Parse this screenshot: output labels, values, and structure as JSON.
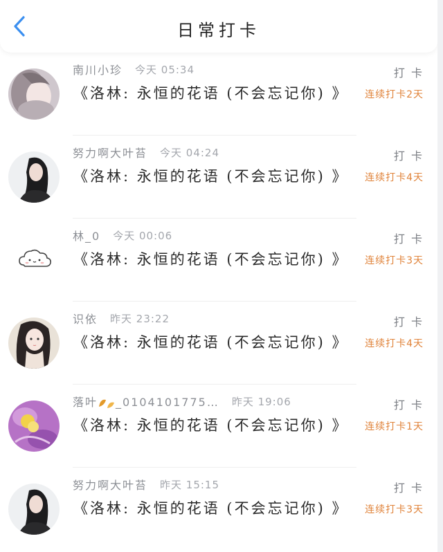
{
  "header": {
    "title": "日常打卡",
    "back_icon": "chevron-left-icon",
    "accent": "#3b8ff0"
  },
  "colors": {
    "streak": "#e0833a",
    "name": "#8c8f95",
    "book": "#2a2a2a"
  },
  "rows": [
    {
      "name": "南川小珍",
      "time": "今天 05:34",
      "book": "《洛林: 永恒的花语 (不会忘记你) 》",
      "action": "打 卡",
      "streak": "连续打卡2天",
      "avatar": "avatar-girl-pink"
    },
    {
      "name": "努力啊大叶苔",
      "time": "今天 04:24",
      "book": "《洛林: 永恒的花语 (不会忘记你) 》",
      "action": "打 卡",
      "streak": "连续打卡4天",
      "avatar": "avatar-girl-dark-hair"
    },
    {
      "name": "林_0",
      "time": "今天 00:06",
      "book": "《洛林: 永恒的花语 (不会忘记你) 》",
      "action": "打 卡",
      "streak": "连续打卡3天",
      "avatar": "avatar-cloud"
    },
    {
      "name": "识依",
      "time": "昨天 23:22",
      "book": "《洛林: 永恒的花语 (不会忘记你) 》",
      "action": "打 卡",
      "streak": "连续打卡4天",
      "avatar": "avatar-anime-girl"
    },
    {
      "name": "落叶",
      "name_suffix": "_0104101775…",
      "time": "昨天 19:06",
      "book": "《洛林: 永恒的花语 (不会忘记你) 》",
      "action": "打 卡",
      "streak": "连续打卡1天",
      "avatar": "avatar-purple-flower"
    },
    {
      "name": "努力啊大叶苔",
      "time": "昨天 15:15",
      "book": "《洛林: 永恒的花语 (不会忘记你) 》",
      "action": "打 卡",
      "streak": "连续打卡3天",
      "avatar": "avatar-girl-dark-hair"
    }
  ]
}
